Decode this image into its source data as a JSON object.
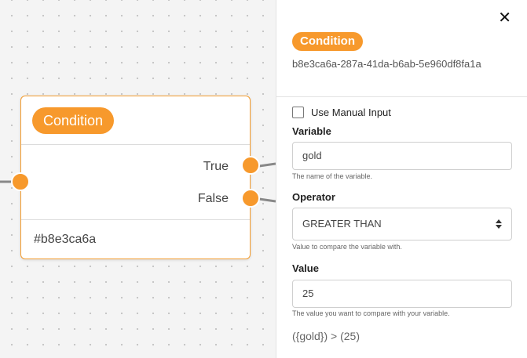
{
  "node": {
    "badge": "Condition",
    "outputs": {
      "true_label": "True",
      "false_label": "False"
    },
    "footer_id": "#b8e3ca6a"
  },
  "panel": {
    "close_symbol": "✕",
    "badge": "Condition",
    "uuid": "b8e3ca6a-287a-41da-b6ab-5e960df8fa1a",
    "manual_input_label": "Use Manual Input",
    "manual_input_checked": false,
    "variable": {
      "label": "Variable",
      "value": "gold",
      "help": "The name of the variable."
    },
    "operator": {
      "label": "Operator",
      "value": "GREATER THAN",
      "help": "Value to compare the variable with."
    },
    "value": {
      "label": "Value",
      "value": "25",
      "help": "The value you want to compare with your variable."
    },
    "expression": "({gold}) > (25)"
  },
  "colors": {
    "accent": "#f7992c",
    "node_border": "#f39c2e",
    "edge": "#888888"
  }
}
